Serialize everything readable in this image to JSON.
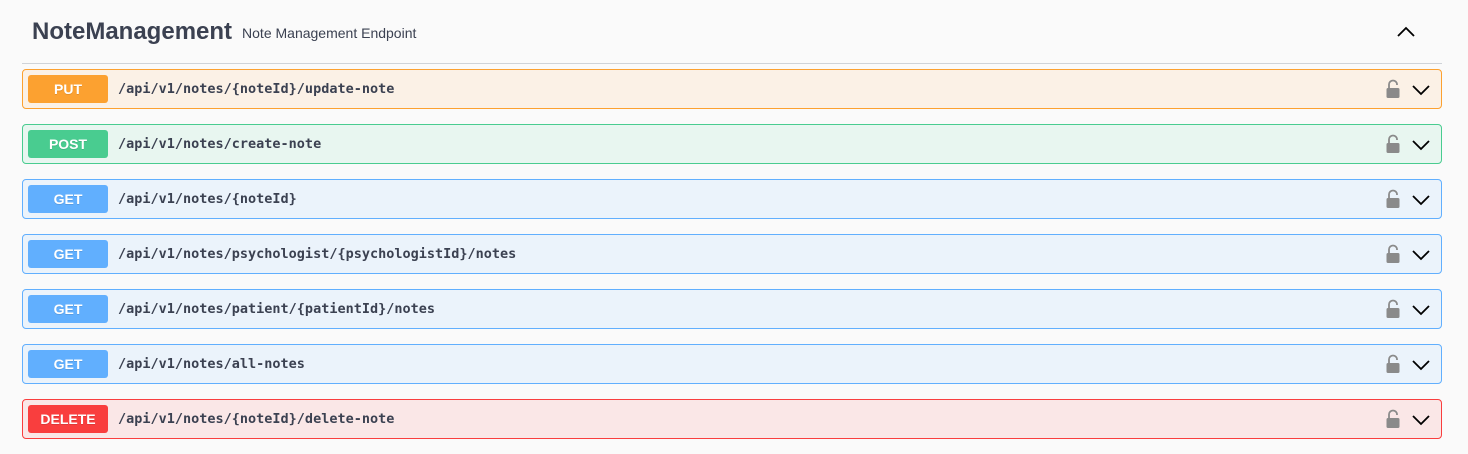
{
  "tag": {
    "name": "NoteManagement",
    "description": "Note Management Endpoint",
    "toggle_icon": "chevron-up-icon"
  },
  "operations": [
    {
      "method": "PUT",
      "path": "/api/v1/notes/{noteId}/update-note",
      "color": "#fca130",
      "bg": "#fbf1e6",
      "border": "#fca130"
    },
    {
      "method": "POST",
      "path": "/api/v1/notes/create-note",
      "color": "#49cc90",
      "bg": "#e8f6f0",
      "border": "#49cc90"
    },
    {
      "method": "GET",
      "path": "/api/v1/notes/{noteId}",
      "color": "#61affe",
      "bg": "#ebf3fb",
      "border": "#61affe"
    },
    {
      "method": "GET",
      "path": "/api/v1/notes/psychologist/{psychologistId}/notes",
      "color": "#61affe",
      "bg": "#ebf3fb",
      "border": "#61affe"
    },
    {
      "method": "GET",
      "path": "/api/v1/notes/patient/{patientId}/notes",
      "color": "#61affe",
      "bg": "#ebf3fb",
      "border": "#61affe"
    },
    {
      "method": "GET",
      "path": "/api/v1/notes/all-notes",
      "color": "#61affe",
      "bg": "#ebf3fb",
      "border": "#61affe"
    },
    {
      "method": "DELETE",
      "path": "/api/v1/notes/{noteId}/delete-note",
      "color": "#f93e3e",
      "bg": "#fae7e7",
      "border": "#f93e3e"
    }
  ],
  "icons": {
    "lock": "lock-icon",
    "expand": "chevron-down-icon"
  }
}
